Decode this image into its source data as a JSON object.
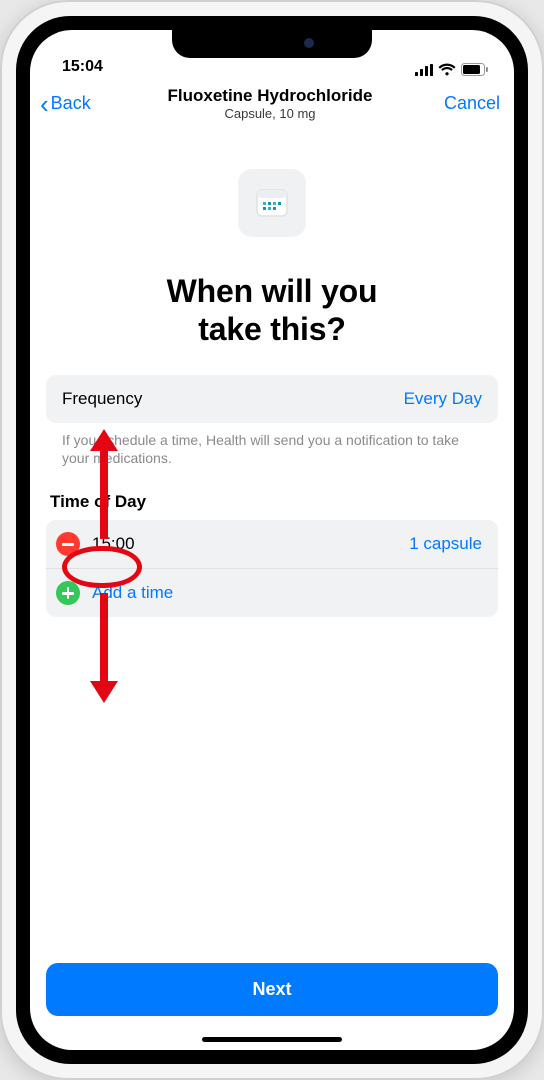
{
  "status": {
    "time": "15:04"
  },
  "nav": {
    "back": "Back",
    "title": "Fluoxetine Hydrochloride",
    "subtitle": "Capsule, 10 mg",
    "cancel": "Cancel"
  },
  "heading_line1": "When will you",
  "heading_line2": "take this?",
  "frequency": {
    "label": "Frequency",
    "value": "Every Day"
  },
  "helper_text": "If you schedule a time, Health will send you a notification to take your medications.",
  "time_section_label": "Time of Day",
  "times": [
    {
      "time": "15:00",
      "dose": "1 capsule"
    }
  ],
  "add_time_label": "Add a time",
  "next_label": "Next",
  "colors": {
    "accent": "#007aff",
    "remove": "#ff3b30",
    "add": "#34c759"
  }
}
